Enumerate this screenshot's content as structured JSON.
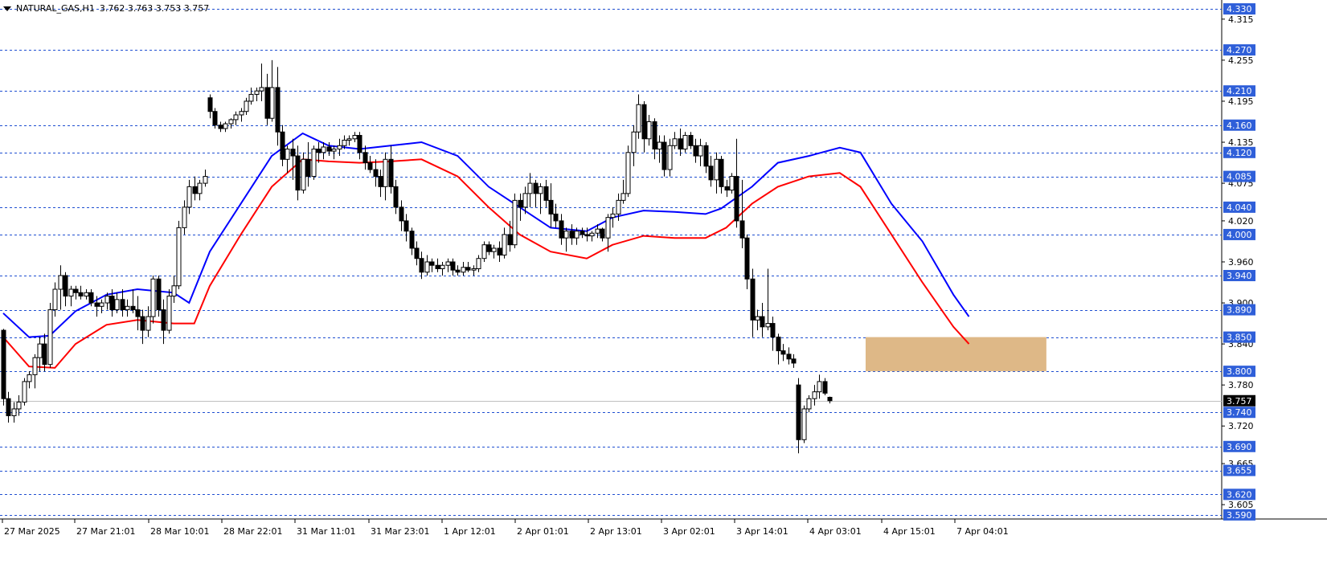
{
  "header": {
    "symbol": "NATURAL_GAS,H1",
    "ohlc": "3.762 3.763 3.753 3.757"
  },
  "colors": {
    "background": "#ffffff",
    "grid_levels": "#1f4fd1",
    "ma_fast": "#0000ff",
    "ma_slow": "#ff0000",
    "zone": "#deb887",
    "price_box": "#000000",
    "level_box": "#2f5fd9"
  },
  "chart_data": {
    "type": "candlestick",
    "symbol": "NATURAL_GAS",
    "timeframe": "H1",
    "y_range": [
      3.584,
      4.343
    ],
    "y_ticks": [
      "4.315",
      "4.255",
      "4.195",
      "4.135",
      "4.075",
      "4.020",
      "3.960",
      "3.900",
      "3.840",
      "3.780",
      "3.720",
      "3.665",
      "3.605"
    ],
    "x_labels": [
      "27 Mar 2025",
      "27 Mar 21:01",
      "28 Mar 10:01",
      "28 Mar 22:01",
      "31 Mar 11:01",
      "31 Mar 23:01",
      "1 Apr 12:01",
      "2 Apr 01:01",
      "2 Apr 13:01",
      "3 Apr 02:01",
      "3 Apr 14:01",
      "4 Apr 03:01",
      "4 Apr 15:01",
      "7 Apr 04:01"
    ],
    "levels": [
      "4.330",
      "4.270",
      "4.210",
      "4.160",
      "4.120",
      "4.085",
      "4.040",
      "4.000",
      "3.940",
      "3.890",
      "3.850",
      "3.800",
      "3.740",
      "3.690",
      "3.655",
      "3.620",
      "3.590"
    ],
    "current_price": "3.757",
    "zone": {
      "from_price": 3.8,
      "to_price": 3.85,
      "from_bar": 167,
      "to_bar": 202
    },
    "ma_fast": [
      [
        0,
        3.885
      ],
      [
        5,
        3.85
      ],
      [
        9,
        3.852
      ],
      [
        14,
        3.888
      ],
      [
        20,
        3.912
      ],
      [
        26,
        3.92
      ],
      [
        33,
        3.915
      ],
      [
        36,
        3.9
      ],
      [
        40,
        3.975
      ],
      [
        46,
        4.045
      ],
      [
        52,
        4.115
      ],
      [
        58,
        4.148
      ],
      [
        63,
        4.13
      ],
      [
        69,
        4.125
      ],
      [
        75,
        4.13
      ],
      [
        81,
        4.135
      ],
      [
        88,
        4.115
      ],
      [
        94,
        4.07
      ],
      [
        100,
        4.04
      ],
      [
        106,
        4.01
      ],
      [
        113,
        4.005
      ],
      [
        118,
        4.025
      ],
      [
        124,
        4.035
      ],
      [
        130,
        4.033
      ],
      [
        136,
        4.03
      ],
      [
        139,
        4.038
      ],
      [
        145,
        4.07
      ],
      [
        150,
        4.105
      ],
      [
        156,
        4.115
      ],
      [
        162,
        4.127
      ],
      [
        166,
        4.12
      ],
      [
        172,
        4.045
      ],
      [
        178,
        3.99
      ],
      [
        184,
        3.912
      ],
      [
        187,
        3.88
      ]
    ],
    "ma_slow": [
      [
        0,
        3.85
      ],
      [
        5,
        3.807
      ],
      [
        10,
        3.805
      ],
      [
        14,
        3.84
      ],
      [
        20,
        3.868
      ],
      [
        26,
        3.875
      ],
      [
        33,
        3.87
      ],
      [
        37,
        3.87
      ],
      [
        40,
        3.925
      ],
      [
        46,
        4.0
      ],
      [
        52,
        4.07
      ],
      [
        58,
        4.11
      ],
      [
        63,
        4.107
      ],
      [
        69,
        4.105
      ],
      [
        75,
        4.107
      ],
      [
        81,
        4.11
      ],
      [
        88,
        4.085
      ],
      [
        94,
        4.04
      ],
      [
        100,
        4.0
      ],
      [
        106,
        3.975
      ],
      [
        113,
        3.965
      ],
      [
        118,
        3.985
      ],
      [
        124,
        3.998
      ],
      [
        130,
        3.995
      ],
      [
        136,
        3.995
      ],
      [
        140,
        4.01
      ],
      [
        145,
        4.045
      ],
      [
        150,
        4.07
      ],
      [
        156,
        4.085
      ],
      [
        162,
        4.09
      ],
      [
        166,
        4.07
      ],
      [
        172,
        4.0
      ],
      [
        178,
        3.93
      ],
      [
        184,
        3.865
      ],
      [
        187,
        3.84
      ]
    ],
    "candles": [
      [
        3.86,
        3.862,
        3.75,
        3.76
      ],
      [
        3.76,
        3.77,
        3.725,
        3.735
      ],
      [
        3.735,
        3.755,
        3.725,
        3.745
      ],
      [
        3.745,
        3.765,
        3.735,
        3.755
      ],
      [
        3.755,
        3.79,
        3.75,
        3.785
      ],
      [
        3.785,
        3.8,
        3.775,
        3.795
      ],
      [
        3.795,
        3.825,
        3.775,
        3.82
      ],
      [
        3.82,
        3.85,
        3.8,
        3.84
      ],
      [
        3.84,
        3.855,
        3.8,
        3.81
      ],
      [
        3.81,
        3.9,
        3.805,
        3.89
      ],
      [
        3.89,
        3.93,
        3.88,
        3.92
      ],
      [
        3.92,
        3.955,
        3.89,
        3.94
      ],
      [
        3.94,
        3.945,
        3.895,
        3.91
      ],
      [
        3.91,
        3.925,
        3.895,
        3.92
      ],
      [
        3.92,
        3.925,
        3.905,
        3.915
      ],
      [
        3.915,
        3.925,
        3.905,
        3.91
      ],
      [
        3.91,
        3.92,
        3.905,
        3.915
      ],
      [
        3.915,
        3.92,
        3.895,
        3.9
      ],
      [
        3.9,
        3.91,
        3.88,
        3.895
      ],
      [
        3.895,
        3.905,
        3.885,
        3.9
      ],
      [
        3.9,
        3.915,
        3.89,
        3.91
      ],
      [
        3.91,
        3.92,
        3.88,
        3.89
      ],
      [
        3.89,
        3.915,
        3.885,
        3.905
      ],
      [
        3.905,
        3.92,
        3.88,
        3.89
      ],
      [
        3.89,
        3.905,
        3.88,
        3.895
      ],
      [
        3.895,
        3.92,
        3.885,
        3.89
      ],
      [
        3.89,
        3.91,
        3.86,
        3.88
      ],
      [
        3.88,
        3.89,
        3.84,
        3.86
      ],
      [
        3.86,
        3.895,
        3.85,
        3.88
      ],
      [
        3.88,
        3.94,
        3.87,
        3.935
      ],
      [
        3.935,
        3.94,
        3.88,
        3.89
      ],
      [
        3.89,
        3.905,
        3.84,
        3.86
      ],
      [
        3.86,
        3.92,
        3.855,
        3.91
      ],
      [
        3.91,
        3.94,
        3.9,
        3.925
      ],
      [
        3.925,
        4.02,
        3.92,
        4.01
      ],
      [
        4.01,
        4.05,
        4.0,
        4.04
      ],
      [
        4.04,
        4.08,
        4.03,
        4.07
      ],
      [
        4.07,
        4.085,
        4.05,
        4.06
      ],
      [
        4.06,
        4.08,
        4.05,
        4.075
      ],
      [
        4.075,
        4.095,
        4.07,
        4.085
      ],
      [
        4.2,
        4.205,
        4.17,
        4.18
      ],
      [
        4.18,
        4.185,
        4.155,
        4.16
      ],
      [
        4.16,
        4.165,
        4.15,
        4.155
      ],
      [
        4.155,
        4.165,
        4.15,
        4.162
      ],
      [
        4.162,
        4.17,
        4.155,
        4.168
      ],
      [
        4.168,
        4.18,
        4.16,
        4.175
      ],
      [
        4.175,
        4.185,
        4.165,
        4.18
      ],
      [
        4.18,
        4.2,
        4.175,
        4.195
      ],
      [
        4.195,
        4.215,
        4.19,
        4.205
      ],
      [
        4.205,
        4.215,
        4.195,
        4.21
      ],
      [
        4.21,
        4.25,
        4.195,
        4.215
      ],
      [
        4.215,
        4.235,
        4.16,
        4.17
      ],
      [
        4.17,
        4.255,
        4.165,
        4.215
      ],
      [
        4.215,
        4.245,
        4.13,
        4.15
      ],
      [
        4.15,
        4.16,
        4.1,
        4.11
      ],
      [
        4.11,
        4.13,
        4.09,
        4.125
      ],
      [
        4.125,
        4.14,
        4.08,
        4.115
      ],
      [
        4.115,
        4.13,
        4.05,
        4.065
      ],
      [
        4.065,
        4.12,
        4.06,
        4.11
      ],
      [
        4.11,
        4.135,
        4.07,
        4.085
      ],
      [
        4.085,
        4.13,
        4.08,
        4.125
      ],
      [
        4.125,
        4.135,
        4.105,
        4.12
      ],
      [
        4.12,
        4.135,
        4.11,
        4.128
      ],
      [
        4.128,
        4.135,
        4.115,
        4.122
      ],
      [
        4.122,
        4.13,
        4.11,
        4.125
      ],
      [
        4.125,
        4.14,
        4.115,
        4.13
      ],
      [
        4.13,
        4.145,
        4.125,
        4.138
      ],
      [
        4.138,
        4.145,
        4.13,
        4.14
      ],
      [
        4.14,
        4.15,
        4.135,
        4.145
      ],
      [
        4.145,
        4.15,
        4.11,
        4.12
      ],
      [
        4.12,
        4.13,
        4.095,
        4.105
      ],
      [
        4.105,
        4.115,
        4.09,
        4.095
      ],
      [
        4.095,
        4.11,
        4.07,
        4.085
      ],
      [
        4.085,
        4.095,
        4.055,
        4.07
      ],
      [
        4.07,
        4.12,
        4.05,
        4.11
      ],
      [
        4.11,
        4.13,
        4.06,
        4.07
      ],
      [
        4.07,
        4.08,
        4.03,
        4.04
      ],
      [
        4.04,
        4.05,
        4.005,
        4.02
      ],
      [
        4.02,
        4.03,
        3.99,
        4.005
      ],
      [
        4.005,
        4.01,
        3.97,
        3.98
      ],
      [
        3.98,
        3.99,
        3.955,
        3.965
      ],
      [
        3.965,
        3.975,
        3.935,
        3.945
      ],
      [
        3.945,
        3.97,
        3.94,
        3.96
      ],
      [
        3.96,
        3.965,
        3.945,
        3.955
      ],
      [
        3.955,
        3.965,
        3.945,
        3.95
      ],
      [
        3.95,
        3.96,
        3.94,
        3.955
      ],
      [
        3.955,
        3.965,
        3.945,
        3.96
      ],
      [
        3.96,
        3.965,
        3.94,
        3.948
      ],
      [
        3.948,
        3.955,
        3.94,
        3.945
      ],
      [
        3.945,
        3.96,
        3.94,
        3.952
      ],
      [
        3.952,
        3.96,
        3.945,
        3.948
      ],
      [
        3.948,
        3.955,
        3.94,
        3.95
      ],
      [
        3.95,
        3.97,
        3.945,
        3.965
      ],
      [
        3.965,
        3.99,
        3.96,
        3.985
      ],
      [
        3.985,
        3.99,
        3.97,
        3.975
      ],
      [
        3.975,
        3.985,
        3.965,
        3.98
      ],
      [
        3.98,
        3.99,
        3.96,
        3.97
      ],
      [
        3.97,
        4.01,
        3.965,
        4.0
      ],
      [
        4.0,
        4.02,
        3.975,
        3.985
      ],
      [
        3.985,
        4.06,
        3.98,
        4.05
      ],
      [
        4.05,
        4.06,
        4.02,
        4.04
      ],
      [
        4.04,
        4.07,
        4.03,
        4.06
      ],
      [
        4.06,
        4.09,
        4.04,
        4.075
      ],
      [
        4.075,
        4.08,
        4.04,
        4.06
      ],
      [
        4.06,
        4.075,
        4.03,
        4.07
      ],
      [
        4.07,
        4.08,
        4.04,
        4.05
      ],
      [
        4.05,
        4.075,
        4.01,
        4.03
      ],
      [
        4.03,
        4.045,
        4.01,
        4.02
      ],
      [
        4.02,
        4.03,
        3.985,
        3.995
      ],
      [
        3.995,
        4.01,
        3.975,
        4.005
      ],
      [
        4.005,
        4.015,
        3.985,
        3.995
      ],
      [
        3.995,
        4.01,
        3.985,
        4.005
      ],
      [
        4.005,
        4.01,
        3.995,
        4.0
      ],
      [
        4.0,
        4.01,
        3.99,
        3.998
      ],
      [
        3.998,
        4.005,
        3.99,
        4.002
      ],
      [
        4.002,
        4.015,
        3.995,
        4.008
      ],
      [
        4.008,
        4.01,
        3.99,
        3.995
      ],
      [
        3.995,
        4.03,
        3.975,
        4.025
      ],
      [
        4.025,
        4.04,
        4.01,
        4.03
      ],
      [
        4.03,
        4.06,
        4.02,
        4.05
      ],
      [
        4.05,
        4.08,
        4.045,
        4.06
      ],
      [
        4.06,
        4.13,
        4.055,
        4.12
      ],
      [
        4.12,
        4.16,
        4.1,
        4.15
      ],
      [
        4.15,
        4.205,
        4.14,
        4.19
      ],
      [
        4.19,
        4.195,
        4.12,
        4.14
      ],
      [
        4.14,
        4.175,
        4.13,
        4.165
      ],
      [
        4.165,
        4.17,
        4.11,
        4.125
      ],
      [
        4.125,
        4.145,
        4.105,
        4.135
      ],
      [
        4.135,
        4.145,
        4.085,
        4.095
      ],
      [
        4.095,
        4.14,
        4.085,
        4.13
      ],
      [
        4.13,
        4.15,
        4.125,
        4.14
      ],
      [
        4.14,
        4.155,
        4.115,
        4.125
      ],
      [
        4.125,
        4.15,
        4.12,
        4.145
      ],
      [
        4.145,
        4.15,
        4.125,
        4.13
      ],
      [
        4.13,
        4.14,
        4.105,
        4.115
      ],
      [
        4.115,
        4.14,
        4.1,
        4.13
      ],
      [
        4.13,
        4.135,
        4.09,
        4.1
      ],
      [
        4.1,
        4.115,
        4.07,
        4.08
      ],
      [
        4.08,
        4.12,
        4.06,
        4.11
      ],
      [
        4.11,
        4.115,
        4.06,
        4.07
      ],
      [
        4.07,
        4.08,
        4.055,
        4.065
      ],
      [
        4.065,
        4.09,
        4.06,
        4.085
      ],
      [
        4.085,
        4.14,
        4.01,
        4.02
      ],
      [
        4.02,
        4.08,
        3.98,
        3.995
      ],
      [
        3.995,
        4.0,
        3.92,
        3.935
      ],
      [
        3.935,
        3.95,
        3.85,
        3.875
      ],
      [
        3.875,
        3.89,
        3.86,
        3.88
      ],
      [
        3.88,
        3.9,
        3.85,
        3.865
      ],
      [
        3.865,
        3.95,
        3.86,
        3.87
      ],
      [
        3.87,
        3.88,
        3.83,
        3.85
      ],
      [
        3.85,
        3.855,
        3.81,
        3.83
      ],
      [
        3.83,
        3.84,
        3.815,
        3.825
      ],
      [
        3.825,
        3.835,
        3.81,
        3.818
      ],
      [
        3.818,
        3.825,
        3.805,
        3.812
      ],
      [
        3.78,
        3.79,
        3.68,
        3.7
      ],
      [
        3.7,
        3.75,
        3.695,
        3.745
      ],
      [
        3.745,
        3.765,
        3.74,
        3.76
      ],
      [
        3.76,
        3.78,
        3.75,
        3.77
      ],
      [
        3.77,
        3.795,
        3.76,
        3.785
      ],
      [
        3.785,
        3.79,
        3.765,
        3.768
      ],
      [
        3.762,
        3.763,
        3.753,
        3.757
      ]
    ],
    "candle_slots": [
      0,
      1,
      2,
      3,
      4,
      5,
      6,
      7,
      8,
      9,
      10,
      11,
      12,
      13,
      14,
      15,
      16,
      17,
      18,
      19,
      20,
      21,
      22,
      23,
      24,
      25,
      26,
      27,
      28,
      29,
      30,
      31,
      32,
      33,
      34,
      35,
      36,
      37,
      38,
      39,
      40,
      41,
      42,
      43,
      44,
      45,
      46,
      47,
      48,
      49,
      50,
      51,
      52,
      53,
      54,
      55,
      56,
      57,
      58,
      59,
      60,
      61,
      62,
      63,
      64,
      65,
      66,
      67,
      68,
      69,
      70,
      71,
      72,
      73,
      74,
      75,
      76,
      77,
      78,
      79,
      80,
      81,
      82,
      83,
      84,
      85,
      86,
      87,
      88,
      89,
      90,
      91,
      92,
      93,
      94,
      95,
      96,
      97,
      98,
      99,
      100,
      101,
      102,
      103,
      104,
      105,
      106,
      107,
      108,
      109,
      110,
      111,
      112,
      113,
      114,
      115,
      116,
      117,
      118,
      119,
      120,
      121,
      122,
      123,
      124,
      125,
      126,
      127,
      128,
      129,
      130,
      131,
      132,
      133,
      134,
      135,
      136,
      137,
      138,
      139,
      140,
      141,
      142,
      143,
      144,
      145,
      146,
      147,
      148,
      149,
      150,
      151,
      152,
      153,
      154,
      155,
      156,
      157,
      158,
      159,
      160,
      161,
      162,
      163,
      164,
      165,
      166,
      167,
      168,
      169,
      170,
      171,
      172,
      173,
      174,
      175,
      176,
      177,
      178,
      179,
      180,
      181,
      182,
      183,
      184,
      185,
      186,
      187
    ]
  }
}
